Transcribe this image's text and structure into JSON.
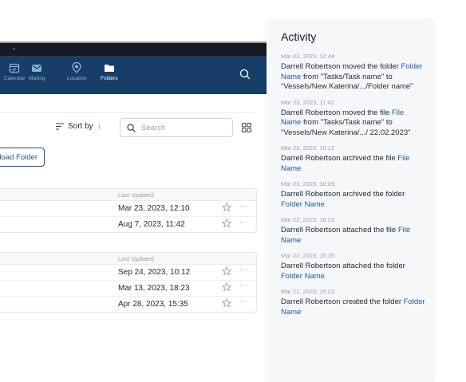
{
  "nav": {
    "items": [
      {
        "label": "Calendar",
        "icon": "calendar-icon",
        "active": false
      },
      {
        "label": "Mailing",
        "icon": "mail-icon",
        "active": false
      },
      {
        "label": "Location",
        "icon": "location-pin-icon",
        "active": false
      },
      {
        "label": "Folders",
        "icon": "folder-icon",
        "active": true
      }
    ]
  },
  "toolbar": {
    "sort_label": "Sort by",
    "sort_arrow": "↓",
    "search_placeholder": "Search",
    "upload_label": "Upload Folder",
    "upload_visible": "load Folder"
  },
  "tables": [
    {
      "header_date": "Last Updated",
      "rows": [
        {
          "date": "Mar 23, 2023, 12:10"
        },
        {
          "date": "Aug 7, 2023, 11:42"
        }
      ]
    },
    {
      "header_date": "Last Updated",
      "rows": [
        {
          "date": "Sep 24, 2023, 10:12"
        },
        {
          "date": "Mar 13, 2023, 18:23"
        },
        {
          "date": "Apr 28, 2023, 15:35"
        }
      ]
    }
  ],
  "activity": {
    "title": "Activity",
    "entries": [
      {
        "time": "Mar 23, 2023, 12:44",
        "pre": "Darrell Robertson moved the folder ",
        "link": "Folder Name",
        "post": " from \"Tasks/Task name\" to \"Vessels/New Katerina/.../Folder name\""
      },
      {
        "time": "Mar 23, 2023, 11:42",
        "pre": "Darrell Robertson moved the file ",
        "link": "File Name",
        "post": " from \"Tasks/Task name\" to \"Vessels/New Katerina/.../ 22.02.2023\""
      },
      {
        "time": "Mar 23, 2023, 10:12",
        "pre": "Darrell Robertson archived the file ",
        "link": "File Name",
        "post": ""
      },
      {
        "time": "Mar 23, 2023, 10:09",
        "pre": "Darrell Robertson archived the folder ",
        "link": "Folder Name",
        "post": ""
      },
      {
        "time": "Mar 22, 2023, 18:23",
        "pre": "Darrell Robertson attached the file ",
        "link": "File Name",
        "post": ""
      },
      {
        "time": "Mar 22, 2023, 15:35",
        "pre": "Darrell Robertson attached the folder ",
        "link": "Folder Name",
        "post": ""
      },
      {
        "time": "Mar 22, 2023, 15:23",
        "pre": "Darrell Robertson created the folder ",
        "link": "Folder Name",
        "post": ""
      }
    ]
  },
  "colors": {
    "navbar": "#163e69",
    "link": "#1e5aa8",
    "panel_bg": "#f6f7f9"
  }
}
